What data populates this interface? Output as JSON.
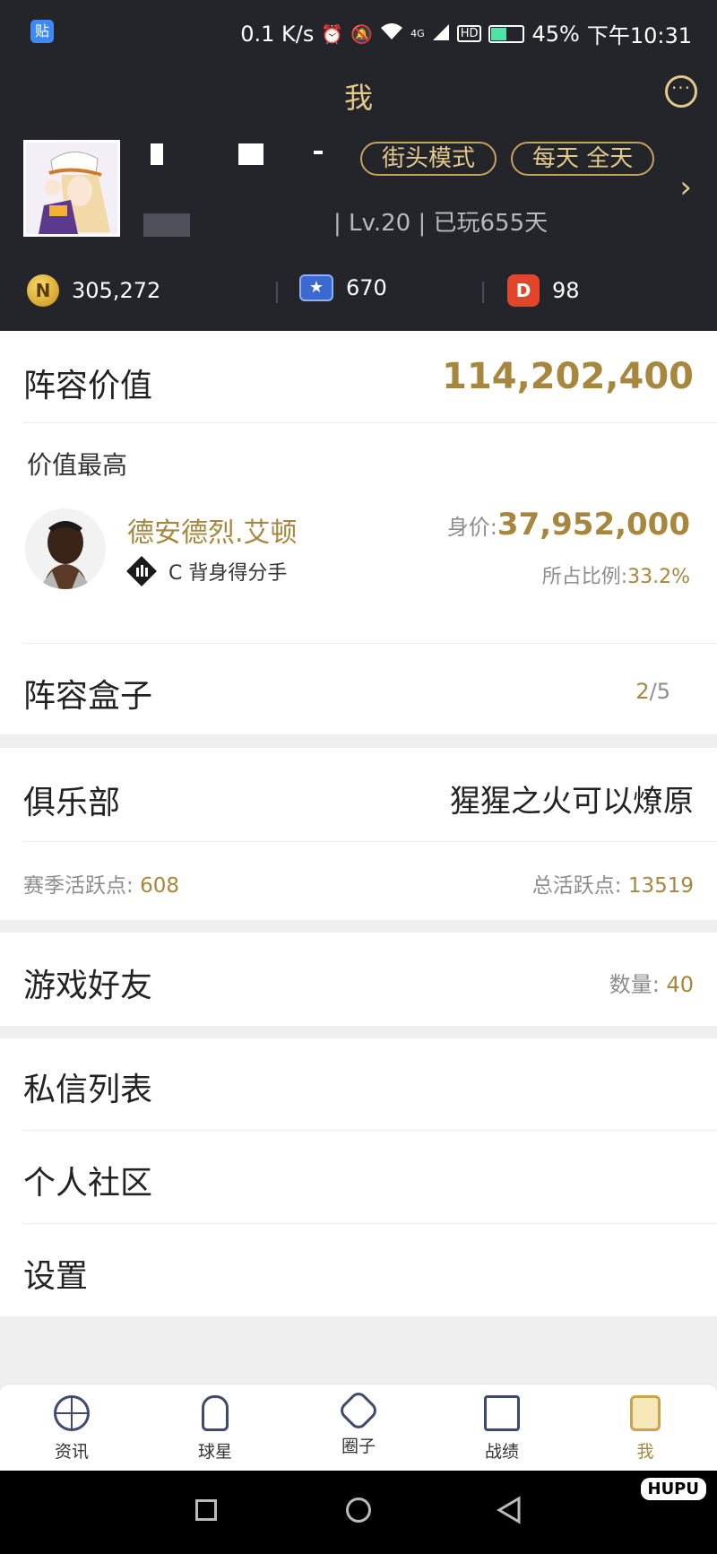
{
  "status_bar": {
    "app_badge": "贴",
    "net_speed": "0.1 K/s",
    "network": "4G",
    "hd": "HD",
    "battery": "45%",
    "time": "下午10:31"
  },
  "header": {
    "title": "我"
  },
  "profile": {
    "mode_tag": "街头模式",
    "time_tag": "每天 全天",
    "level_text": "| Lv.20 | 已玩655天"
  },
  "currencies": [
    {
      "icon": "coin-icon",
      "label": "N",
      "value": "305,272"
    },
    {
      "icon": "star-badge-icon",
      "label": "★",
      "value": "670"
    },
    {
      "icon": "d-badge-icon",
      "label": "D",
      "value": "98"
    }
  ],
  "lineup_value": {
    "label": "阵容价值",
    "value": "114,202,400"
  },
  "top_value": {
    "label": "价值最高",
    "player_name": "德安德烈.艾顿",
    "position": "C 背身得分手",
    "price_label": "身价: ",
    "price": "37,952,000",
    "ratio_label": "所占比例: ",
    "ratio": "33.2%"
  },
  "lineup_box": {
    "label": "阵容盒子",
    "count_current": "2",
    "count_total": "/5"
  },
  "club": {
    "label": "俱乐部",
    "name": "猩猩之火可以燎原",
    "season_active_label": "赛季活跃点: ",
    "season_active": "608",
    "total_active_label": "总活跃点: ",
    "total_active": "13519"
  },
  "friends": {
    "label": "游戏好友",
    "count_label": "数量: ",
    "count": "40"
  },
  "menu": {
    "messages": "私信列表",
    "community": "个人社区",
    "settings": "设置"
  },
  "bottom_nav": [
    {
      "label": "资讯",
      "icon": "basketball-icon"
    },
    {
      "label": "球星",
      "icon": "player-icon"
    },
    {
      "label": "圈子",
      "icon": "circle-icon"
    },
    {
      "label": "战绩",
      "icon": "hoop-icon"
    },
    {
      "label": "我",
      "icon": "me-icon"
    }
  ],
  "watermark": "HUPU",
  "colors": {
    "dark_bg": "#24252b",
    "gold": "#a6873d",
    "accent": "#e2c88a"
  }
}
